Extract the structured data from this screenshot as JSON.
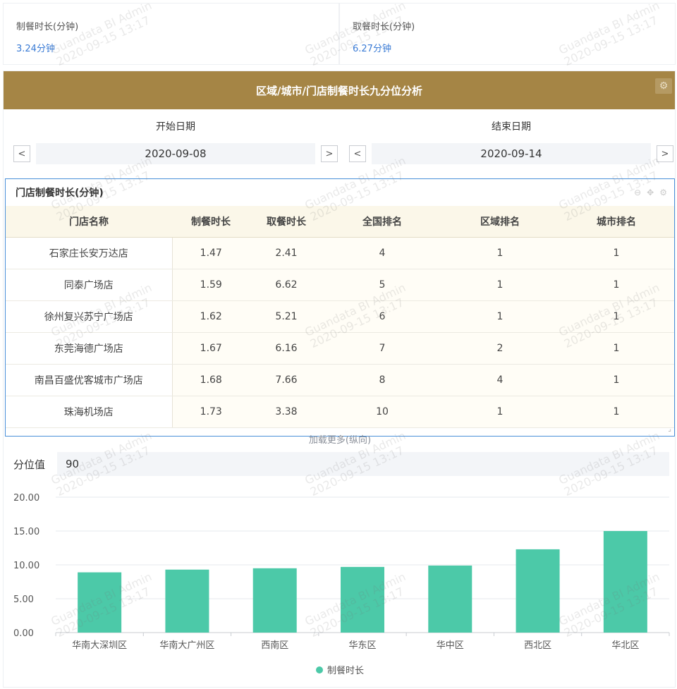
{
  "kpis": [
    {
      "label": "制餐时长(分钟)",
      "value": "3.24分钟"
    },
    {
      "label": "取餐时长(分钟)",
      "value": "6.27分钟"
    }
  ],
  "panel": {
    "title": "区域/城市/门店制餐时长九分位分析"
  },
  "dates": {
    "start_label": "开始日期",
    "start_value": "2020-09-08",
    "end_label": "结束日期",
    "end_value": "2020-09-14",
    "prev_icon": "<",
    "next_icon": ">"
  },
  "table": {
    "title": "门店制餐时长(分钟)",
    "columns": [
      "门店名称",
      "制餐时长",
      "取餐时长",
      "全国排名",
      "区域排名",
      "城市排名"
    ],
    "rows": [
      [
        "石家庄长安万达店",
        "1.47",
        "2.41",
        "4",
        "1",
        "1"
      ],
      [
        "同泰广场店",
        "1.59",
        "6.62",
        "5",
        "1",
        "1"
      ],
      [
        "徐州复兴苏宁广场店",
        "1.62",
        "5.21",
        "6",
        "1",
        "1"
      ],
      [
        "东莞海德广场店",
        "1.67",
        "6.16",
        "7",
        "2",
        "1"
      ],
      [
        "南昌百盛优客城市广场店",
        "1.68",
        "7.66",
        "8",
        "4",
        "1"
      ],
      [
        "珠海机场店",
        "1.73",
        "3.38",
        "10",
        "1",
        "1"
      ]
    ],
    "load_more": "加载更多(纵向)"
  },
  "percentile": {
    "label": "分位值",
    "value": "90"
  },
  "chart_data": {
    "type": "bar",
    "categories": [
      "华南大深圳区",
      "华南大广州区",
      "西南区",
      "华东区",
      "华中区",
      "西北区",
      "华北区"
    ],
    "series": [
      {
        "name": "制餐时长",
        "values": [
          8.9,
          9.3,
          9.5,
          9.7,
          9.9,
          12.3,
          15.0
        ],
        "color": "#4cc9a8"
      }
    ],
    "ylim": [
      0,
      20
    ],
    "yticks": [
      "0.00",
      "5.00",
      "10.00",
      "15.00",
      "20.00"
    ],
    "grid": true,
    "legend": "bottom"
  },
  "watermark": {
    "line1": "Guandata BI Admin",
    "line2": "2020-09-15 13:17"
  },
  "colors": {
    "header": "#a58545",
    "accent": "#3a7bd5",
    "bar": "#4cc9a8"
  }
}
